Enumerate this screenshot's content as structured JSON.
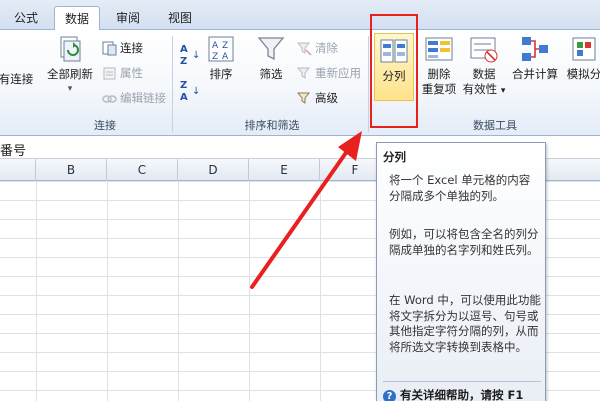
{
  "tabs": [
    "公式",
    "数据",
    "审阅",
    "视图"
  ],
  "active_tab": "数据",
  "groups": {
    "connections": {
      "label": "连接",
      "refresh_all": "全部刷新",
      "connect_partial": "有连接",
      "connections": "连接",
      "properties": "属性",
      "edit_links": "编辑链接"
    },
    "sort_filter": {
      "label": "排序和筛选",
      "sort": "排序",
      "filter": "筛选",
      "clear": "清除",
      "reapply": "重新应用",
      "advanced": "高级"
    },
    "data_tools": {
      "label": "数据工具",
      "text_to_columns": "分列",
      "remove_dup_1": "删除",
      "remove_dup_2": "重复项",
      "validation_1": "数据",
      "validation_2": "有效性",
      "consolidate": "合并计算",
      "whatif_partial": "模拟分"
    }
  },
  "formula_bar": {
    "cell_text": "番号"
  },
  "columns": [
    "B",
    "C",
    "D",
    "E",
    "F"
  ],
  "tooltip": {
    "title": "分列",
    "para1": "将一个 Excel 单元格的内容分隔成多个单独的列。",
    "para2": "例如，可以将包含全名的列分隔成单独的名字列和姓氏列。",
    "para3": "在 Word 中，可以使用此功能将文字拆分为以逗号、句号或其他指定字符分隔的列，从而将所选文字转换到表格中。",
    "help": "有关详细帮助，请按 F1"
  },
  "colors": {
    "highlight": "#e8201e",
    "ribbon_bg": "#dfe8f5",
    "arrow": "#e8201e"
  }
}
